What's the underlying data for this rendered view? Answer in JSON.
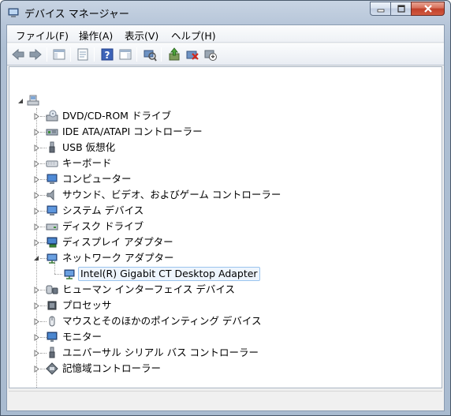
{
  "window": {
    "title": "デバイス マネージャー"
  },
  "menubar": {
    "items": [
      "ファイル(F)",
      "操作(A)",
      "表示(V)",
      "ヘルプ(H)"
    ]
  },
  "tree": {
    "root_label": "",
    "categories": [
      {
        "label": "DVD/CD-ROM ドライブ",
        "icon": "dvd-drive-icon"
      },
      {
        "label": "IDE ATA/ATAPI コントローラー",
        "icon": "ide-controller-icon"
      },
      {
        "label": "USB 仮想化",
        "icon": "usb-icon"
      },
      {
        "label": "キーボード",
        "icon": "keyboard-icon"
      },
      {
        "label": "コンピューター",
        "icon": "computer-icon"
      },
      {
        "label": "サウンド、ビデオ、およびゲーム コントローラー",
        "icon": "speaker-icon"
      },
      {
        "label": "システム デバイス",
        "icon": "system-device-icon"
      },
      {
        "label": "ディスク ドライブ",
        "icon": "disk-drive-icon"
      },
      {
        "label": "ディスプレイ アダプター",
        "icon": "display-adapter-icon"
      },
      {
        "label": "ネットワーク アダプター",
        "icon": "network-adapter-icon",
        "expanded": true
      },
      {
        "label": "ヒューマン インターフェイス デバイス",
        "icon": "hid-icon"
      },
      {
        "label": "プロセッサ",
        "icon": "processor-icon"
      },
      {
        "label": "マウスとそのほかのポインティング デバイス",
        "icon": "mouse-icon"
      },
      {
        "label": "モニター",
        "icon": "monitor-icon"
      },
      {
        "label": "ユニバーサル シリアル バス コントローラー",
        "icon": "usb-controller-icon"
      },
      {
        "label": "記憶域コントローラー",
        "icon": "storage-controller-icon"
      }
    ],
    "network_child": {
      "label": "Intel(R) Gigabit CT Desktop Adapter",
      "icon": "network-card-icon",
      "selected": true
    }
  },
  "colors": {
    "selection_bg": "#eef5fd",
    "selection_border": "#9ac4ee",
    "close_button": "#c0402a"
  }
}
